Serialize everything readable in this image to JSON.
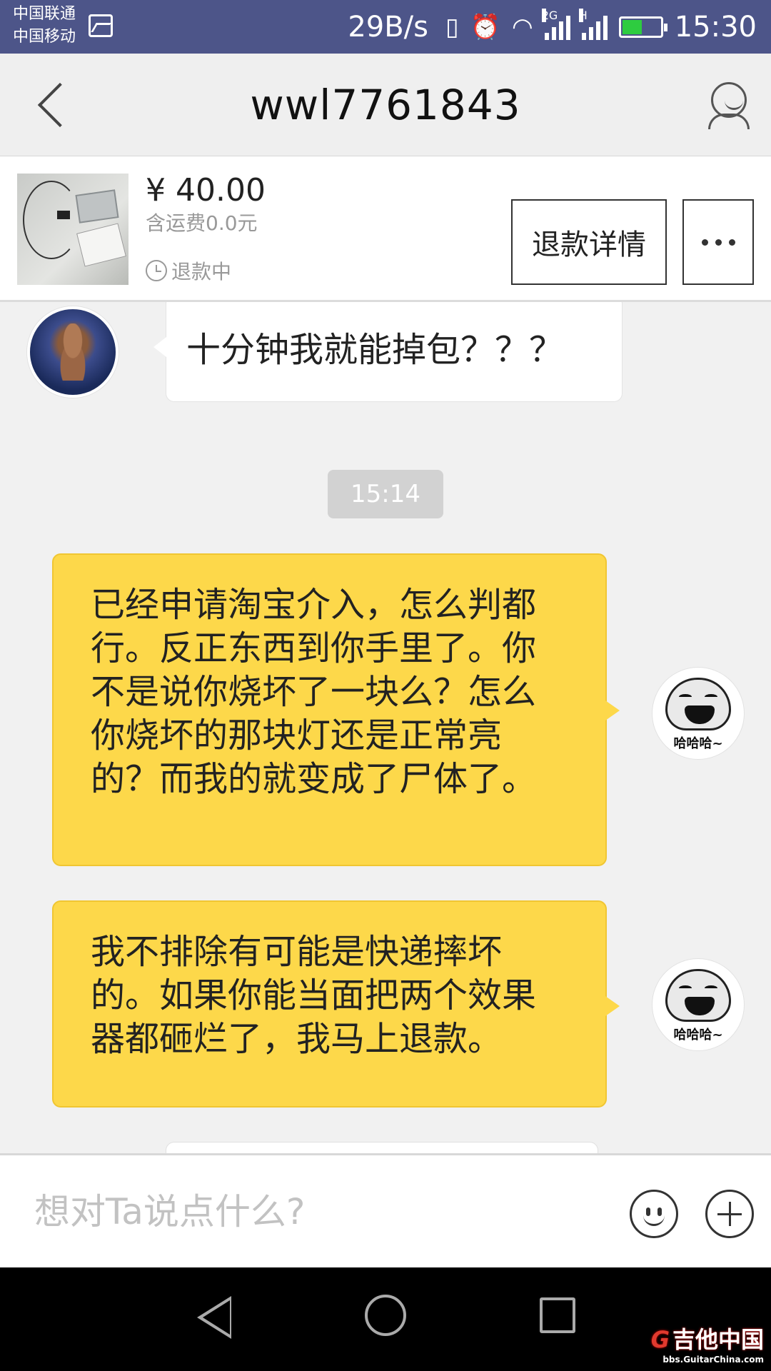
{
  "status_bar": {
    "carrier1": "中国联通",
    "carrier2": "中国移动",
    "net_speed": "29B/s",
    "network_labels": [
      "2G",
      "H"
    ],
    "time": "15:30",
    "battery_level": 0.5,
    "icons": [
      "image-icon",
      "vibrate-icon",
      "alarm-icon",
      "wifi-icon",
      "signal-icon",
      "battery-icon"
    ]
  },
  "header": {
    "title": "wwl7761843",
    "icons": [
      "back-arrow-icon",
      "profile-icon"
    ]
  },
  "order": {
    "price": "¥ 40.00",
    "shipping": "含运费0.0元",
    "status": "退款中",
    "refund_details_label": "退款详情",
    "more_icon": "more-icon"
  },
  "chat": {
    "messages": [
      {
        "side": "left",
        "text": "十分钟我就能掉包？？？"
      },
      {
        "side": "right",
        "lines": [
          "已经申请淘宝介入，怎么判都",
          "行。反正东西到你手里了。你",
          "不是说你烧坏了一块么？怎么",
          "你烧坏的那块灯还是正常亮",
          "的？而我的就变成了尸体了。"
        ]
      },
      {
        "side": "right",
        "lines": [
          "我不排除有可能是快递摔坏",
          "的。如果你能当面把两个效果",
          "器都砸烂了，我马上退款。"
        ]
      }
    ],
    "timestamp": "15:14",
    "meme_caption": "哈哈哈~"
  },
  "input": {
    "placeholder": "想对Ta说点什么?",
    "icons": [
      "emoji-icon",
      "plus-icon"
    ]
  },
  "nav": {
    "icons": [
      "nav-back-icon",
      "nav-home-icon",
      "nav-recent-icon"
    ]
  },
  "watermark": {
    "logo_text": "吉他中国",
    "site": "bbs.GuitarChina.com"
  },
  "colors": {
    "status_bar": "#4d5589",
    "bubble_self": "#fdd84a",
    "bubble_other": "#ffffff",
    "chat_bg": "#f1f1f1"
  }
}
